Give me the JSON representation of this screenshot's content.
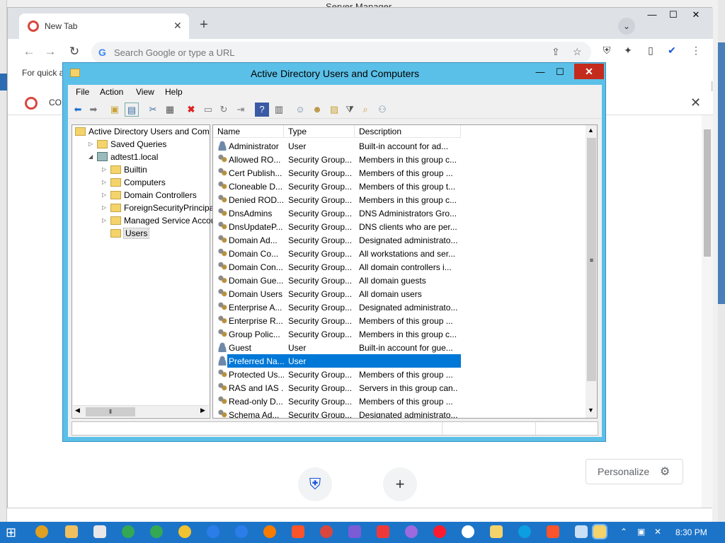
{
  "server_manager": {
    "title": "Server Manager"
  },
  "browser": {
    "tab_title": "New Tab",
    "tab_close": "✕",
    "new_tab": "+",
    "omnibox_placeholder": "Search Google or type a URL",
    "bookmarks_text": "For quick a",
    "infobar_text": "CO",
    "infobar_close": "✕",
    "personalize_label": "Personalize",
    "win_controls": {
      "minimize": "—",
      "maximize": "☐",
      "close": "✕"
    }
  },
  "aduc": {
    "title": "Active Directory Users and Computers",
    "menu": [
      "File",
      "Action",
      "View",
      "Help"
    ],
    "tree": [
      {
        "label": "Active Directory Users and Com",
        "level": 0,
        "expander": "",
        "icon": "aduc"
      },
      {
        "label": "Saved Queries",
        "level": 1,
        "expander": "▷",
        "icon": "folder"
      },
      {
        "label": "adtest1.local",
        "level": 1,
        "expander": "◢",
        "icon": "domain"
      },
      {
        "label": "Builtin",
        "level": 2,
        "expander": "▷",
        "icon": "folder"
      },
      {
        "label": "Computers",
        "level": 2,
        "expander": "▷",
        "icon": "folder"
      },
      {
        "label": "Domain Controllers",
        "level": 2,
        "expander": "▷",
        "icon": "folder"
      },
      {
        "label": "ForeignSecurityPrincipals",
        "level": 2,
        "expander": "▷",
        "icon": "folder"
      },
      {
        "label": "Managed Service Accour",
        "level": 2,
        "expander": "▷",
        "icon": "folder"
      },
      {
        "label": "Users",
        "level": 2,
        "expander": "",
        "icon": "folder"
      }
    ],
    "columns": [
      "Name",
      "Type",
      "Description"
    ],
    "rows": [
      {
        "name": "Administrator",
        "type": "User",
        "desc": "Built-in account for ad...",
        "kind": "user"
      },
      {
        "name": "Allowed RO...",
        "type": "Security Group...",
        "desc": "Members in this group c...",
        "kind": "group"
      },
      {
        "name": "Cert Publish...",
        "type": "Security Group...",
        "desc": "Members of this group ...",
        "kind": "group"
      },
      {
        "name": "Cloneable D...",
        "type": "Security Group...",
        "desc": "Members of this group t...",
        "kind": "group"
      },
      {
        "name": "Denied ROD...",
        "type": "Security Group...",
        "desc": "Members in this group c...",
        "kind": "group"
      },
      {
        "name": "DnsAdmins",
        "type": "Security Group...",
        "desc": "DNS Administrators Gro...",
        "kind": "group"
      },
      {
        "name": "DnsUpdateP...",
        "type": "Security Group...",
        "desc": "DNS clients who are per...",
        "kind": "group"
      },
      {
        "name": "Domain Ad...",
        "type": "Security Group...",
        "desc": "Designated administrato...",
        "kind": "group"
      },
      {
        "name": "Domain Co...",
        "type": "Security Group...",
        "desc": "All workstations and ser...",
        "kind": "group"
      },
      {
        "name": "Domain Con...",
        "type": "Security Group...",
        "desc": "All domain controllers i...",
        "kind": "group"
      },
      {
        "name": "Domain Gue...",
        "type": "Security Group...",
        "desc": "All domain guests",
        "kind": "group"
      },
      {
        "name": "Domain Users",
        "type": "Security Group...",
        "desc": "All domain users",
        "kind": "group"
      },
      {
        "name": "Enterprise A...",
        "type": "Security Group...",
        "desc": "Designated administrato...",
        "kind": "group"
      },
      {
        "name": "Enterprise R...",
        "type": "Security Group...",
        "desc": "Members of this group ...",
        "kind": "group"
      },
      {
        "name": "Group Polic...",
        "type": "Security Group...",
        "desc": "Members in this group c...",
        "kind": "group"
      },
      {
        "name": "Guest",
        "type": "User",
        "desc": "Built-in account for gue...",
        "kind": "user"
      },
      {
        "name": "Preferred Na...",
        "type": "User",
        "desc": "",
        "kind": "user",
        "selected": true
      },
      {
        "name": "Protected Us...",
        "type": "Security Group...",
        "desc": "Members of this group ...",
        "kind": "group"
      },
      {
        "name": "RAS and IAS ...",
        "type": "Security Group...",
        "desc": "Servers in this group can...",
        "kind": "group"
      },
      {
        "name": "Read-only D...",
        "type": "Security Group...",
        "desc": "Members of this group ...",
        "kind": "group"
      },
      {
        "name": "Schema Ad...",
        "type": "Security Group...",
        "desc": "Designated administrato...",
        "kind": "group"
      }
    ]
  },
  "taskbar": {
    "time": "8:30 PM"
  },
  "colors": {
    "selection": "#0078d7",
    "titlebar": "#5bc0e8",
    "close": "#c42b1c",
    "taskbar": "#1c74c8"
  }
}
